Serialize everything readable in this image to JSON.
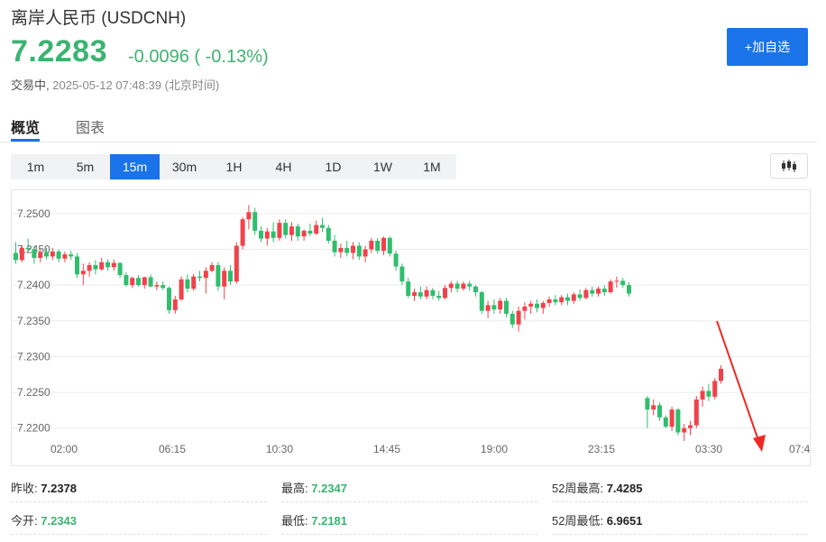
{
  "header": {
    "title": "离岸人民币 (USDCNH)",
    "price": "7.2283",
    "change": "-0.0096 ( -0.13%)",
    "status_label": "交易中,",
    "timestamp": "2025-05-12 07:48:39 (北京时间)",
    "add_button": "+加自选"
  },
  "tabs": [
    {
      "label": "概览",
      "active": true
    },
    {
      "label": "图表",
      "active": false
    }
  ],
  "intervals": [
    {
      "label": "1m"
    },
    {
      "label": "5m"
    },
    {
      "label": "15m",
      "active": true
    },
    {
      "label": "30m"
    },
    {
      "label": "1H"
    },
    {
      "label": "4H"
    },
    {
      "label": "1D"
    },
    {
      "label": "1W"
    },
    {
      "label": "1M"
    }
  ],
  "colors": {
    "up": "#f0424b",
    "down": "#2fbe6d",
    "accent": "#1a73e8",
    "annotation_arrow": "#ee2a24"
  },
  "chart_data": {
    "type": "candlestick",
    "y_ticks": [
      "7.2500",
      "7.2450",
      "7.2400",
      "7.2350",
      "7.2300",
      "7.2250",
      "7.2200"
    ],
    "x_ticks": [
      "02:00",
      "06:15",
      "10:30",
      "14:45",
      "19:00",
      "23:15",
      "03:30",
      "07:4"
    ],
    "ylim": [
      7.2182,
      7.2525
    ],
    "grid": true,
    "annotation": "red arrow pointing to the intraday low",
    "series": [
      {
        "segment": 1,
        "start_index": 0,
        "ohlc": [
          [
            7.2445,
            7.246,
            7.243,
            7.2435
          ],
          [
            7.2435,
            7.2455,
            7.2432,
            7.2452
          ],
          [
            7.2452,
            7.2465,
            7.2448,
            7.245
          ],
          [
            7.245,
            7.2455,
            7.243,
            7.2438
          ],
          [
            7.2438,
            7.245,
            7.2432,
            7.2446
          ],
          [
            7.2446,
            7.2452,
            7.2436,
            7.244
          ],
          [
            7.244,
            7.2452,
            7.2435,
            7.2447
          ],
          [
            7.2447,
            7.245,
            7.2432,
            7.2437
          ],
          [
            7.2437,
            7.2447,
            7.2432,
            7.2443
          ],
          [
            7.2443,
            7.2448,
            7.2435,
            7.244
          ],
          [
            7.244,
            7.2445,
            7.241,
            7.2415
          ],
          [
            7.2415,
            7.243,
            7.24,
            7.242
          ],
          [
            7.242,
            7.2432,
            7.2412,
            7.2428
          ],
          [
            7.2428,
            7.2435,
            7.2415,
            7.2422
          ],
          [
            7.2422,
            7.2438,
            7.242,
            7.2432
          ],
          [
            7.2432,
            7.2436,
            7.242,
            7.2425
          ],
          [
            7.2425,
            7.2436,
            7.242,
            7.2431
          ],
          [
            7.2431,
            7.2432,
            7.241,
            7.2414
          ],
          [
            7.2414,
            7.2418,
            7.2398,
            7.24
          ],
          [
            7.24,
            7.2412,
            7.2396,
            7.241
          ],
          [
            7.241,
            7.2414,
            7.2398,
            7.24
          ],
          [
            7.24,
            7.2412,
            7.2395,
            7.2411
          ],
          [
            7.2411,
            7.2415,
            7.2397,
            7.2398
          ],
          [
            7.2398,
            7.2405,
            7.2393,
            7.24
          ],
          [
            7.24,
            7.2405,
            7.2393,
            7.2396
          ],
          [
            7.2396,
            7.2398,
            7.236,
            7.2365
          ],
          [
            7.2365,
            7.2385,
            7.236,
            7.238
          ],
          [
            7.238,
            7.2412,
            7.2378,
            7.2408
          ],
          [
            7.2408,
            7.2415,
            7.239,
            7.2395
          ],
          [
            7.2395,
            7.2416,
            7.2392,
            7.2412
          ],
          [
            7.2412,
            7.242,
            7.2405,
            7.241
          ],
          [
            7.241,
            7.2425,
            7.2388,
            7.242
          ],
          [
            7.242,
            7.2432,
            7.2418,
            7.2428
          ],
          [
            7.2428,
            7.2432,
            7.2392,
            7.2398
          ],
          [
            7.2398,
            7.2425,
            7.238,
            7.242
          ],
          [
            7.242,
            7.2428,
            7.24,
            7.2405
          ],
          [
            7.2405,
            7.246,
            7.2402,
            7.2455
          ],
          [
            7.2455,
            7.2495,
            7.245,
            7.2492
          ],
          [
            7.2492,
            7.2512,
            7.2478,
            7.2502
          ],
          [
            7.2502,
            7.2508,
            7.247,
            7.2476
          ],
          [
            7.2476,
            7.2482,
            7.246,
            7.2465
          ],
          [
            7.2465,
            7.248,
            7.2455,
            7.2475
          ],
          [
            7.2475,
            7.2488,
            7.246,
            7.2466
          ],
          [
            7.2466,
            7.2492,
            7.2462,
            7.2487
          ],
          [
            7.2487,
            7.2492,
            7.2465,
            7.247
          ],
          [
            7.247,
            7.2488,
            7.2462,
            7.2482
          ],
          [
            7.2482,
            7.2486,
            7.2462,
            7.2468
          ],
          [
            7.2468,
            7.2478,
            7.2462,
            7.2476
          ],
          [
            7.2476,
            7.2486,
            7.2468,
            7.2472
          ],
          [
            7.2472,
            7.249,
            7.247,
            7.2484
          ],
          [
            7.2484,
            7.2494,
            7.2474,
            7.248
          ],
          [
            7.248,
            7.2484,
            7.2458,
            7.2462
          ],
          [
            7.2462,
            7.247,
            7.244,
            7.2446
          ],
          [
            7.2446,
            7.2458,
            7.2438,
            7.2452
          ],
          [
            7.2452,
            7.2462,
            7.244,
            7.2445
          ],
          [
            7.2445,
            7.246,
            7.2436,
            7.2455
          ],
          [
            7.2455,
            7.246,
            7.2435,
            7.244
          ],
          [
            7.244,
            7.2455,
            7.2432,
            7.245
          ],
          [
            7.245,
            7.2466,
            7.2445,
            7.2462
          ],
          [
            7.2462,
            7.2466,
            7.2444,
            7.2448
          ],
          [
            7.2448,
            7.2468,
            7.2442,
            7.2466
          ],
          [
            7.2466,
            7.2468,
            7.244,
            7.2444
          ],
          [
            7.2444,
            7.2448,
            7.242,
            7.2426
          ],
          [
            7.2426,
            7.243,
            7.24,
            7.2405
          ],
          [
            7.2405,
            7.241,
            7.2382,
            7.2385
          ],
          [
            7.2385,
            7.2395,
            7.2378,
            7.239
          ],
          [
            7.239,
            7.2398,
            7.238,
            7.2384
          ],
          [
            7.2384,
            7.2398,
            7.238,
            7.2393
          ],
          [
            7.2393,
            7.2396,
            7.238,
            7.2385
          ],
          [
            7.2385,
            7.2392,
            7.2378,
            7.2382
          ],
          [
            7.2382,
            7.24,
            7.238,
            7.2396
          ],
          [
            7.2396,
            7.2406,
            7.239,
            7.2402
          ],
          [
            7.2402,
            7.2406,
            7.239,
            7.2395
          ],
          [
            7.2395,
            7.2405,
            7.2392,
            7.2402
          ],
          [
            7.2402,
            7.2406,
            7.2392,
            7.2398
          ],
          [
            7.2398,
            7.24,
            7.2384,
            7.239
          ],
          [
            7.239,
            7.2392,
            7.236,
            7.2364
          ],
          [
            7.2364,
            7.2378,
            7.2354,
            7.2372
          ],
          [
            7.2372,
            7.238,
            7.236,
            7.2366
          ],
          [
            7.2366,
            7.2382,
            7.236,
            7.2378
          ],
          [
            7.2378,
            7.2382,
            7.2355,
            7.236
          ],
          [
            7.236,
            7.2364,
            7.234,
            7.2345
          ],
          [
            7.2345,
            7.237,
            7.2335,
            7.2364
          ],
          [
            7.2364,
            7.2376,
            7.2352,
            7.237
          ],
          [
            7.237,
            7.2378,
            7.236,
            7.2374
          ],
          [
            7.2374,
            7.238,
            7.2362,
            7.2368
          ],
          [
            7.2368,
            7.2378,
            7.236,
            7.2375
          ],
          [
            7.2375,
            7.2384,
            7.237,
            7.238
          ],
          [
            7.238,
            7.2386,
            7.2372,
            7.2376
          ],
          [
            7.2376,
            7.2386,
            7.2372,
            7.2383
          ],
          [
            7.2383,
            7.2388,
            7.2372,
            7.2378
          ],
          [
            7.2378,
            7.239,
            7.2374,
            7.2387
          ],
          [
            7.2387,
            7.2394,
            7.2378,
            7.2382
          ],
          [
            7.2382,
            7.2396,
            7.238,
            7.2393
          ],
          [
            7.2393,
            7.2398,
            7.2384,
            7.2388
          ],
          [
            7.2388,
            7.2398,
            7.2384,
            7.2395
          ],
          [
            7.2395,
            7.24,
            7.2385,
            7.239
          ],
          [
            7.239,
            7.2408,
            7.2388,
            7.2405
          ],
          [
            7.2405,
            7.2412,
            7.2396,
            7.2406
          ],
          [
            7.2406,
            7.241,
            7.2396,
            7.24
          ],
          [
            7.24,
            7.2404,
            7.2384,
            7.2388
          ]
        ]
      },
      {
        "segment": 2,
        "start_index": 103,
        "ohlc": [
          [
            7.2242,
            7.2245,
            7.22,
            7.2226
          ],
          [
            7.2226,
            7.224,
            7.2218,
            7.2232
          ],
          [
            7.2232,
            7.2236,
            7.221,
            7.2215
          ],
          [
            7.2215,
            7.2218,
            7.22,
            7.2202
          ],
          [
            7.2202,
            7.223,
            7.2196,
            7.2226
          ],
          [
            7.2226,
            7.2228,
            7.219,
            7.2194
          ],
          [
            7.2194,
            7.2206,
            7.2182,
            7.22
          ],
          [
            7.22,
            7.221,
            7.219,
            7.2204
          ],
          [
            7.2204,
            7.2245,
            7.22,
            7.224
          ],
          [
            7.224,
            7.2258,
            7.223,
            7.2252
          ],
          [
            7.2252,
            7.2262,
            7.2238,
            7.2244
          ],
          [
            7.2244,
            7.227,
            7.224,
            7.2266
          ],
          [
            7.2266,
            7.2288,
            7.2262,
            7.2283
          ]
        ]
      }
    ]
  },
  "stats": {
    "prev_close": {
      "label": "昨收:",
      "value": "7.2378"
    },
    "open": {
      "label": "今开:",
      "value": "7.2343"
    },
    "high": {
      "label": "最高:",
      "value": "7.2347"
    },
    "low": {
      "label": "最低:",
      "value": "7.2181"
    },
    "w52_high": {
      "label": "52周最高:",
      "value": "7.4285"
    },
    "w52_low": {
      "label": "52周最低:",
      "value": "6.9651"
    }
  }
}
